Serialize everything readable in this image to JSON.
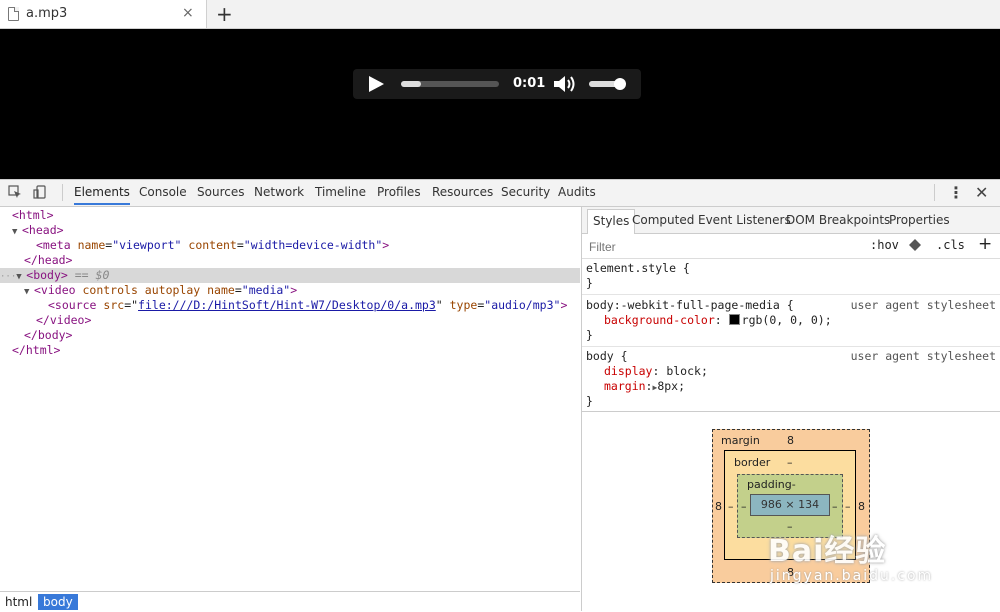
{
  "browser": {
    "tab_title": "a.mp3",
    "close_glyph": "×",
    "new_tab_glyph": "+"
  },
  "player": {
    "time": "0:01",
    "progress_fraction": 0.2,
    "volume_fraction": 0.95
  },
  "devtools": {
    "tabs": [
      "Elements",
      "Console",
      "Sources",
      "Network",
      "Timeline",
      "Profiles",
      "Resources",
      "Security",
      "Audits"
    ],
    "active_tab": "Elements",
    "more_glyph": "⋮",
    "close_glyph": "✕"
  },
  "dom": {
    "html_open": "<html>",
    "head_open": "<head>",
    "meta_tag_open": "<meta",
    "meta_attr1_name": "name",
    "meta_attr1_value": "\"viewport\"",
    "meta_attr2_name": "content",
    "meta_attr2_value": "\"width=device-width\"",
    "meta_close": ">",
    "head_close": "</head>",
    "body_open": "<body>",
    "body_selected_suffix": "== $0",
    "video_open": "<video",
    "video_attrs": "controls autoplay",
    "video_attr_name": "name",
    "video_attr_value": "\"media\"",
    "video_close_bracket": ">",
    "source_open": "<source",
    "source_src_name": "src",
    "source_src_value": "file:///D:/HintSoft/Hint-W7/Desktop/0/a.mp3",
    "source_type_name": "type",
    "source_type_value": "\"audio/mp3\"",
    "source_close": ">",
    "video_close": "</video>",
    "body_close": "</body>",
    "html_close": "</html>"
  },
  "breadcrumbs": [
    "html",
    "body"
  ],
  "sidebar": {
    "tabs": [
      "Styles",
      "Computed",
      "Event Listeners",
      "DOM Breakpoints",
      "Properties"
    ],
    "active_tab": "Styles",
    "filter_placeholder": "Filter",
    "hov": ":hov",
    "cls": ".cls",
    "plus": "+",
    "rules": {
      "element_style_selector": "element.style {",
      "element_style_close": "}",
      "r1_selector": "body:-webkit-full-page-media {",
      "r1_origin": "user agent stylesheet",
      "r1_prop": "background-color",
      "r1_value": "rgb(0, 0, 0);",
      "r1_close": "}",
      "r2_selector": "body {",
      "r2_origin": "user agent stylesheet",
      "r2_prop1": "display",
      "r2_value1": "block;",
      "r2_prop2": "margin",
      "r2_value2": "8px;",
      "r2_close": "}"
    },
    "box_model": {
      "margin_label": "margin",
      "margin_top": "8",
      "margin_left": "8",
      "margin_right": "8",
      "margin_bottom": "8",
      "border_label": "border",
      "border_top": "–",
      "border_left": "–",
      "border_right": "–",
      "padding_label": "padding-",
      "padding_left": "–",
      "padding_right": "–",
      "padding_bottom": "–",
      "content_size": "986 × 134"
    }
  },
  "watermark": {
    "text": "Bai经验",
    "sub": "jingyan.baidu.com"
  }
}
